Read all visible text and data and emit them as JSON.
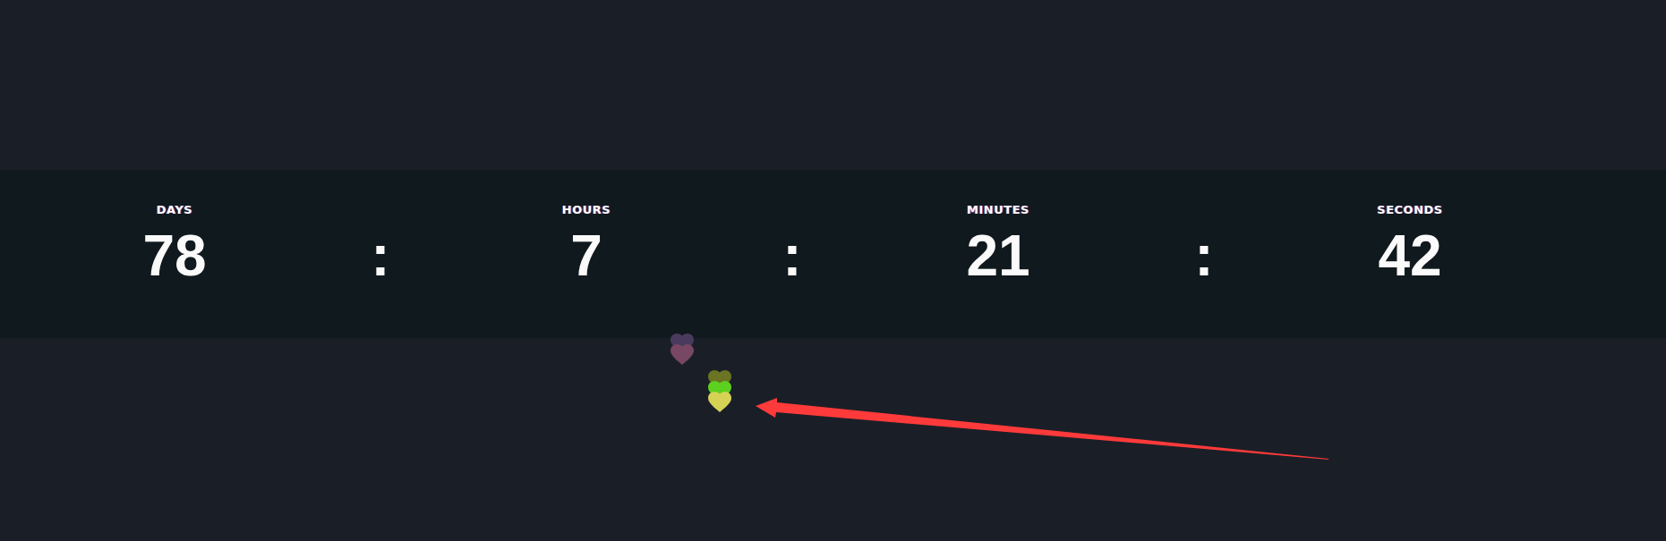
{
  "countdown": {
    "items": [
      {
        "kind": "unit",
        "label": "DAYS",
        "value": "78"
      },
      {
        "kind": "separator",
        "text": ":"
      },
      {
        "kind": "unit",
        "label": "HOURS",
        "value": "7"
      },
      {
        "kind": "separator",
        "text": ":"
      },
      {
        "kind": "unit",
        "label": "MINUTES",
        "value": "21"
      },
      {
        "kind": "separator",
        "text": ":"
      },
      {
        "kind": "unit",
        "label": "SECONDS",
        "value": "42"
      }
    ]
  },
  "hearts": [
    {
      "color": "#4a3b5e"
    },
    {
      "color": "#784764"
    },
    {
      "color": "#6b7422"
    },
    {
      "color": "#5cd11f"
    },
    {
      "color": "#d6d255"
    }
  ],
  "annotations": [
    {
      "kind": "arrow"
    }
  ]
}
